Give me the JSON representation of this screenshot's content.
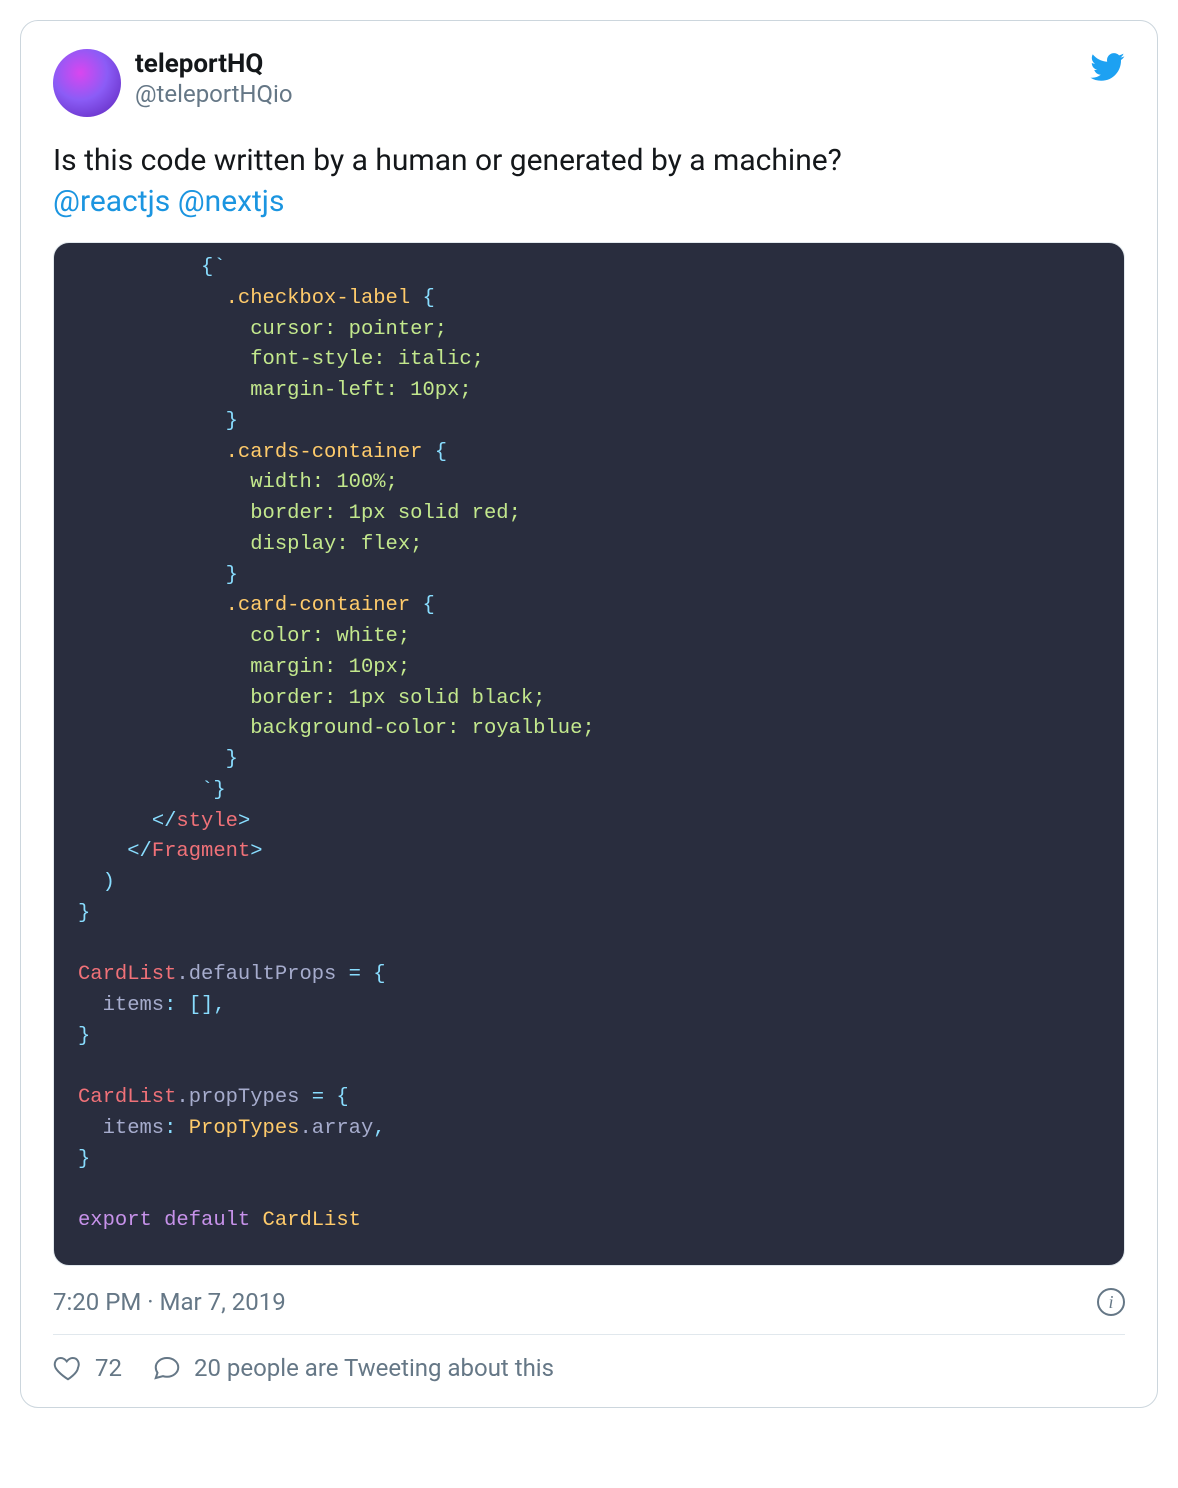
{
  "user": {
    "display_name": "teleportHQ",
    "handle": "@teleportHQio"
  },
  "tweet": {
    "text": "Is this code written by a human or generated by a machine?",
    "mentions": [
      "@reactjs",
      "@nextjs"
    ]
  },
  "code": {
    "bg": "#292d3e",
    "lines": [
      {
        "indent": 10,
        "tokens": [
          {
            "t": "punc",
            "v": "{`"
          }
        ]
      },
      {
        "indent": 12,
        "tokens": [
          {
            "t": "class",
            "v": ".checkbox-label"
          },
          {
            "t": "plain",
            "v": " "
          },
          {
            "t": "punc",
            "v": "{"
          }
        ]
      },
      {
        "indent": 14,
        "tokens": [
          {
            "t": "prop",
            "v": "cursor: pointer;"
          }
        ]
      },
      {
        "indent": 14,
        "tokens": [
          {
            "t": "prop",
            "v": "font-style: italic;"
          }
        ]
      },
      {
        "indent": 14,
        "tokens": [
          {
            "t": "prop",
            "v": "margin-left: 10px;"
          }
        ]
      },
      {
        "indent": 12,
        "tokens": [
          {
            "t": "punc",
            "v": "}"
          }
        ]
      },
      {
        "indent": 12,
        "tokens": [
          {
            "t": "class",
            "v": ".cards-container"
          },
          {
            "t": "plain",
            "v": " "
          },
          {
            "t": "punc",
            "v": "{"
          }
        ]
      },
      {
        "indent": 14,
        "tokens": [
          {
            "t": "prop",
            "v": "width: 100%;"
          }
        ]
      },
      {
        "indent": 14,
        "tokens": [
          {
            "t": "prop",
            "v": "border: 1px solid red;"
          }
        ]
      },
      {
        "indent": 14,
        "tokens": [
          {
            "t": "prop",
            "v": "display: flex;"
          }
        ]
      },
      {
        "indent": 12,
        "tokens": [
          {
            "t": "punc",
            "v": "}"
          }
        ]
      },
      {
        "indent": 12,
        "tokens": [
          {
            "t": "class",
            "v": ".card-container"
          },
          {
            "t": "plain",
            "v": " "
          },
          {
            "t": "punc",
            "v": "{"
          }
        ]
      },
      {
        "indent": 14,
        "tokens": [
          {
            "t": "prop",
            "v": "color: white;"
          }
        ]
      },
      {
        "indent": 14,
        "tokens": [
          {
            "t": "prop",
            "v": "margin: 10px;"
          }
        ]
      },
      {
        "indent": 14,
        "tokens": [
          {
            "t": "prop",
            "v": "border: 1px solid black;"
          }
        ]
      },
      {
        "indent": 14,
        "tokens": [
          {
            "t": "prop",
            "v": "background-color: royalblue;"
          }
        ]
      },
      {
        "indent": 12,
        "tokens": [
          {
            "t": "punc",
            "v": "}"
          }
        ]
      },
      {
        "indent": 10,
        "tokens": [
          {
            "t": "punc",
            "v": "`}"
          }
        ]
      },
      {
        "indent": 6,
        "tokens": [
          {
            "t": "punc",
            "v": "</"
          },
          {
            "t": "tag",
            "v": "style"
          },
          {
            "t": "punc",
            "v": ">"
          }
        ]
      },
      {
        "indent": 4,
        "tokens": [
          {
            "t": "punc",
            "v": "</"
          },
          {
            "t": "tag",
            "v": "Fragment"
          },
          {
            "t": "punc",
            "v": ">"
          }
        ]
      },
      {
        "indent": 2,
        "tokens": [
          {
            "t": "punc",
            "v": ")"
          }
        ]
      },
      {
        "indent": 0,
        "tokens": [
          {
            "t": "punc",
            "v": "}"
          }
        ]
      },
      {
        "indent": 0,
        "tokens": [
          {
            "t": "plain",
            "v": ""
          }
        ]
      },
      {
        "indent": 0,
        "tokens": [
          {
            "t": "id",
            "v": "CardList"
          },
          {
            "t": "plain",
            "v": ".defaultProps "
          },
          {
            "t": "punc",
            "v": "="
          },
          {
            "t": "plain",
            "v": " "
          },
          {
            "t": "punc",
            "v": "{"
          }
        ]
      },
      {
        "indent": 2,
        "tokens": [
          {
            "t": "plain",
            "v": "items"
          },
          {
            "t": "punc",
            "v": ":"
          },
          {
            "t": "plain",
            "v": " "
          },
          {
            "t": "punc",
            "v": "[]"
          },
          {
            "t": "punc",
            "v": ","
          }
        ]
      },
      {
        "indent": 0,
        "tokens": [
          {
            "t": "punc",
            "v": "}"
          }
        ]
      },
      {
        "indent": 0,
        "tokens": [
          {
            "t": "plain",
            "v": ""
          }
        ]
      },
      {
        "indent": 0,
        "tokens": [
          {
            "t": "id",
            "v": "CardList"
          },
          {
            "t": "plain",
            "v": ".propTypes "
          },
          {
            "t": "punc",
            "v": "="
          },
          {
            "t": "plain",
            "v": " "
          },
          {
            "t": "punc",
            "v": "{"
          }
        ]
      },
      {
        "indent": 2,
        "tokens": [
          {
            "t": "plain",
            "v": "items"
          },
          {
            "t": "punc",
            "v": ":"
          },
          {
            "t": "plain",
            "v": " "
          },
          {
            "t": "type",
            "v": "PropTypes"
          },
          {
            "t": "plain",
            "v": ".array"
          },
          {
            "t": "punc",
            "v": ","
          }
        ]
      },
      {
        "indent": 0,
        "tokens": [
          {
            "t": "punc",
            "v": "}"
          }
        ]
      },
      {
        "indent": 0,
        "tokens": [
          {
            "t": "plain",
            "v": ""
          }
        ]
      },
      {
        "indent": 0,
        "tokens": [
          {
            "t": "key",
            "v": "export default"
          },
          {
            "t": "plain",
            "v": " "
          },
          {
            "t": "type",
            "v": "CardList"
          }
        ]
      }
    ]
  },
  "meta": {
    "timestamp": "7:20 PM · Mar 7, 2019"
  },
  "actions": {
    "likes": "72",
    "reply_text": "20 people are Tweeting about this"
  }
}
